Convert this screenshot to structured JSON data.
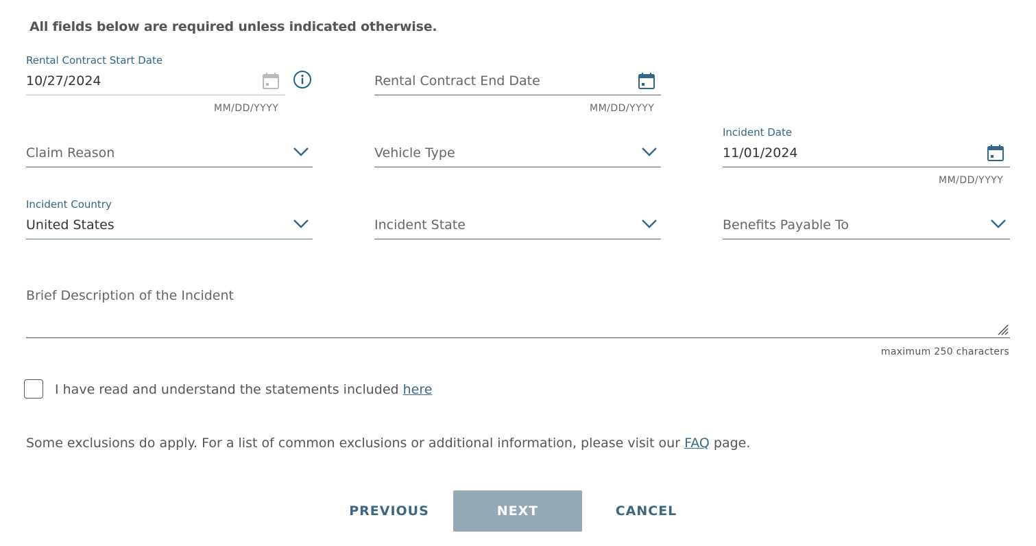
{
  "notice": "All fields below are required unless indicated otherwise.",
  "fields": {
    "rental_start": {
      "label": "Rental Contract Start Date",
      "value": "10/27/2024",
      "hint": "MM/DD/YYYY",
      "icon": "calendar-icon"
    },
    "rental_end": {
      "placeholder": "Rental Contract End Date",
      "hint": "MM/DD/YYYY",
      "icon": "calendar-icon"
    },
    "claim_reason": {
      "placeholder": "Claim Reason",
      "icon": "chevron-down-icon"
    },
    "vehicle_type": {
      "placeholder": "Vehicle Type",
      "icon": "chevron-down-icon"
    },
    "incident_date": {
      "label": "Incident Date",
      "value": "11/01/2024",
      "hint": "MM/DD/YYYY",
      "icon": "calendar-icon"
    },
    "incident_country": {
      "label": "Incident Country",
      "value": "United States",
      "icon": "chevron-down-icon"
    },
    "incident_state": {
      "placeholder": "Incident State",
      "icon": "chevron-down-icon"
    },
    "benefits_payable": {
      "placeholder": "Benefits Payable To",
      "icon": "chevron-down-icon"
    },
    "description": {
      "placeholder": "Brief Description of the Incident",
      "max_hint": "maximum 250 characters"
    }
  },
  "info_icon": "info-icon",
  "agreement": {
    "checked": false,
    "text": "I have read and understand the statements included ",
    "link": "here"
  },
  "exclusions": {
    "text_before": "Some exclusions do apply. For a list of common exclusions or additional information, please visit our ",
    "link": "FAQ",
    "text_after": " page."
  },
  "buttons": {
    "previous": "PREVIOUS",
    "next": "NEXT",
    "cancel": "CANCEL"
  },
  "colors": {
    "accent": "#336688",
    "next_disabled": "#94a9b5",
    "link": "#3b6a85"
  }
}
